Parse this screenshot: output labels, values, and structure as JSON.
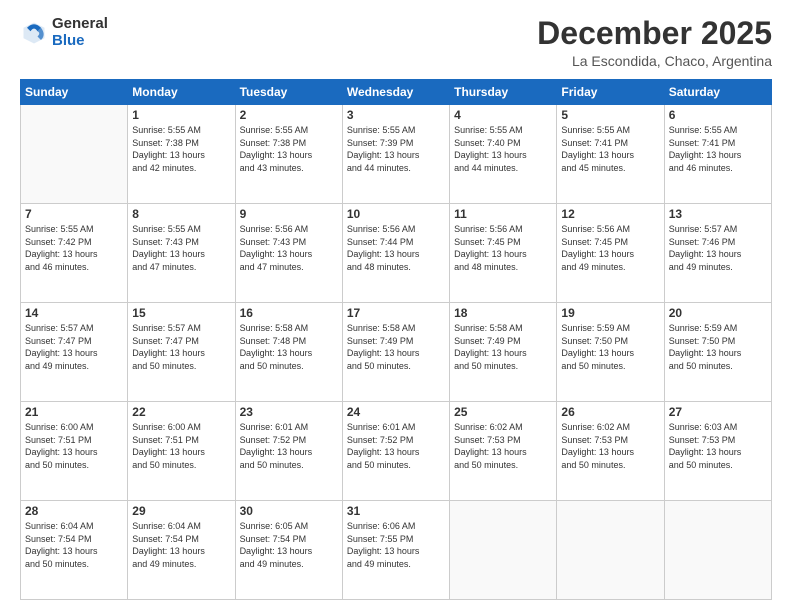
{
  "logo": {
    "general": "General",
    "blue": "Blue"
  },
  "header": {
    "title": "December 2025",
    "subtitle": "La Escondida, Chaco, Argentina"
  },
  "days_of_week": [
    "Sunday",
    "Monday",
    "Tuesday",
    "Wednesday",
    "Thursday",
    "Friday",
    "Saturday"
  ],
  "weeks": [
    [
      {
        "day": "",
        "info": ""
      },
      {
        "day": "1",
        "info": "Sunrise: 5:55 AM\nSunset: 7:38 PM\nDaylight: 13 hours\nand 42 minutes."
      },
      {
        "day": "2",
        "info": "Sunrise: 5:55 AM\nSunset: 7:38 PM\nDaylight: 13 hours\nand 43 minutes."
      },
      {
        "day": "3",
        "info": "Sunrise: 5:55 AM\nSunset: 7:39 PM\nDaylight: 13 hours\nand 44 minutes."
      },
      {
        "day": "4",
        "info": "Sunrise: 5:55 AM\nSunset: 7:40 PM\nDaylight: 13 hours\nand 44 minutes."
      },
      {
        "day": "5",
        "info": "Sunrise: 5:55 AM\nSunset: 7:41 PM\nDaylight: 13 hours\nand 45 minutes."
      },
      {
        "day": "6",
        "info": "Sunrise: 5:55 AM\nSunset: 7:41 PM\nDaylight: 13 hours\nand 46 minutes."
      }
    ],
    [
      {
        "day": "7",
        "info": "Sunrise: 5:55 AM\nSunset: 7:42 PM\nDaylight: 13 hours\nand 46 minutes."
      },
      {
        "day": "8",
        "info": "Sunrise: 5:55 AM\nSunset: 7:43 PM\nDaylight: 13 hours\nand 47 minutes."
      },
      {
        "day": "9",
        "info": "Sunrise: 5:56 AM\nSunset: 7:43 PM\nDaylight: 13 hours\nand 47 minutes."
      },
      {
        "day": "10",
        "info": "Sunrise: 5:56 AM\nSunset: 7:44 PM\nDaylight: 13 hours\nand 48 minutes."
      },
      {
        "day": "11",
        "info": "Sunrise: 5:56 AM\nSunset: 7:45 PM\nDaylight: 13 hours\nand 48 minutes."
      },
      {
        "day": "12",
        "info": "Sunrise: 5:56 AM\nSunset: 7:45 PM\nDaylight: 13 hours\nand 49 minutes."
      },
      {
        "day": "13",
        "info": "Sunrise: 5:57 AM\nSunset: 7:46 PM\nDaylight: 13 hours\nand 49 minutes."
      }
    ],
    [
      {
        "day": "14",
        "info": "Sunrise: 5:57 AM\nSunset: 7:47 PM\nDaylight: 13 hours\nand 49 minutes."
      },
      {
        "day": "15",
        "info": "Sunrise: 5:57 AM\nSunset: 7:47 PM\nDaylight: 13 hours\nand 50 minutes."
      },
      {
        "day": "16",
        "info": "Sunrise: 5:58 AM\nSunset: 7:48 PM\nDaylight: 13 hours\nand 50 minutes."
      },
      {
        "day": "17",
        "info": "Sunrise: 5:58 AM\nSunset: 7:49 PM\nDaylight: 13 hours\nand 50 minutes."
      },
      {
        "day": "18",
        "info": "Sunrise: 5:58 AM\nSunset: 7:49 PM\nDaylight: 13 hours\nand 50 minutes."
      },
      {
        "day": "19",
        "info": "Sunrise: 5:59 AM\nSunset: 7:50 PM\nDaylight: 13 hours\nand 50 minutes."
      },
      {
        "day": "20",
        "info": "Sunrise: 5:59 AM\nSunset: 7:50 PM\nDaylight: 13 hours\nand 50 minutes."
      }
    ],
    [
      {
        "day": "21",
        "info": "Sunrise: 6:00 AM\nSunset: 7:51 PM\nDaylight: 13 hours\nand 50 minutes."
      },
      {
        "day": "22",
        "info": "Sunrise: 6:00 AM\nSunset: 7:51 PM\nDaylight: 13 hours\nand 50 minutes."
      },
      {
        "day": "23",
        "info": "Sunrise: 6:01 AM\nSunset: 7:52 PM\nDaylight: 13 hours\nand 50 minutes."
      },
      {
        "day": "24",
        "info": "Sunrise: 6:01 AM\nSunset: 7:52 PM\nDaylight: 13 hours\nand 50 minutes."
      },
      {
        "day": "25",
        "info": "Sunrise: 6:02 AM\nSunset: 7:53 PM\nDaylight: 13 hours\nand 50 minutes."
      },
      {
        "day": "26",
        "info": "Sunrise: 6:02 AM\nSunset: 7:53 PM\nDaylight: 13 hours\nand 50 minutes."
      },
      {
        "day": "27",
        "info": "Sunrise: 6:03 AM\nSunset: 7:53 PM\nDaylight: 13 hours\nand 50 minutes."
      }
    ],
    [
      {
        "day": "28",
        "info": "Sunrise: 6:04 AM\nSunset: 7:54 PM\nDaylight: 13 hours\nand 50 minutes."
      },
      {
        "day": "29",
        "info": "Sunrise: 6:04 AM\nSunset: 7:54 PM\nDaylight: 13 hours\nand 49 minutes."
      },
      {
        "day": "30",
        "info": "Sunrise: 6:05 AM\nSunset: 7:54 PM\nDaylight: 13 hours\nand 49 minutes."
      },
      {
        "day": "31",
        "info": "Sunrise: 6:06 AM\nSunset: 7:55 PM\nDaylight: 13 hours\nand 49 minutes."
      },
      {
        "day": "",
        "info": ""
      },
      {
        "day": "",
        "info": ""
      },
      {
        "day": "",
        "info": ""
      }
    ]
  ]
}
